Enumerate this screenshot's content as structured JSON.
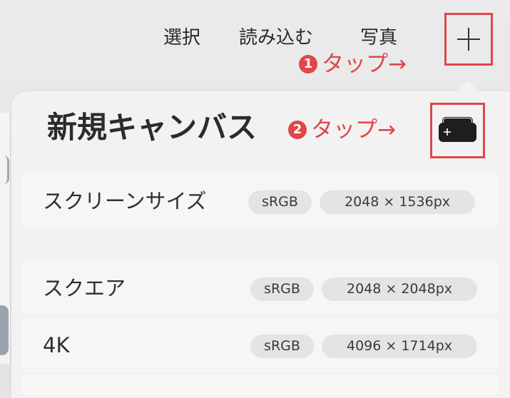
{
  "toolbar": {
    "select_label": "選択",
    "import_label": "読み込む",
    "photo_label": "写真",
    "add_icon": "plus-icon"
  },
  "annotations": {
    "step1": {
      "number": "1",
      "text": "タップ→"
    },
    "step2": {
      "number": "2",
      "text": "タップ→"
    },
    "color": "#e0464a"
  },
  "popover": {
    "title": "新規キャンバス",
    "new_canvas_icon": "new-canvas-icon",
    "presets": [
      {
        "name": "スクリーンサイズ",
        "color_space": "sRGB",
        "size": "2048 × 1536px"
      },
      {
        "name": "スクエア",
        "color_space": "sRGB",
        "size": "2048 × 2048px"
      },
      {
        "name": "4K",
        "color_space": "sRGB",
        "size": "4096 × 1714px"
      }
    ]
  }
}
